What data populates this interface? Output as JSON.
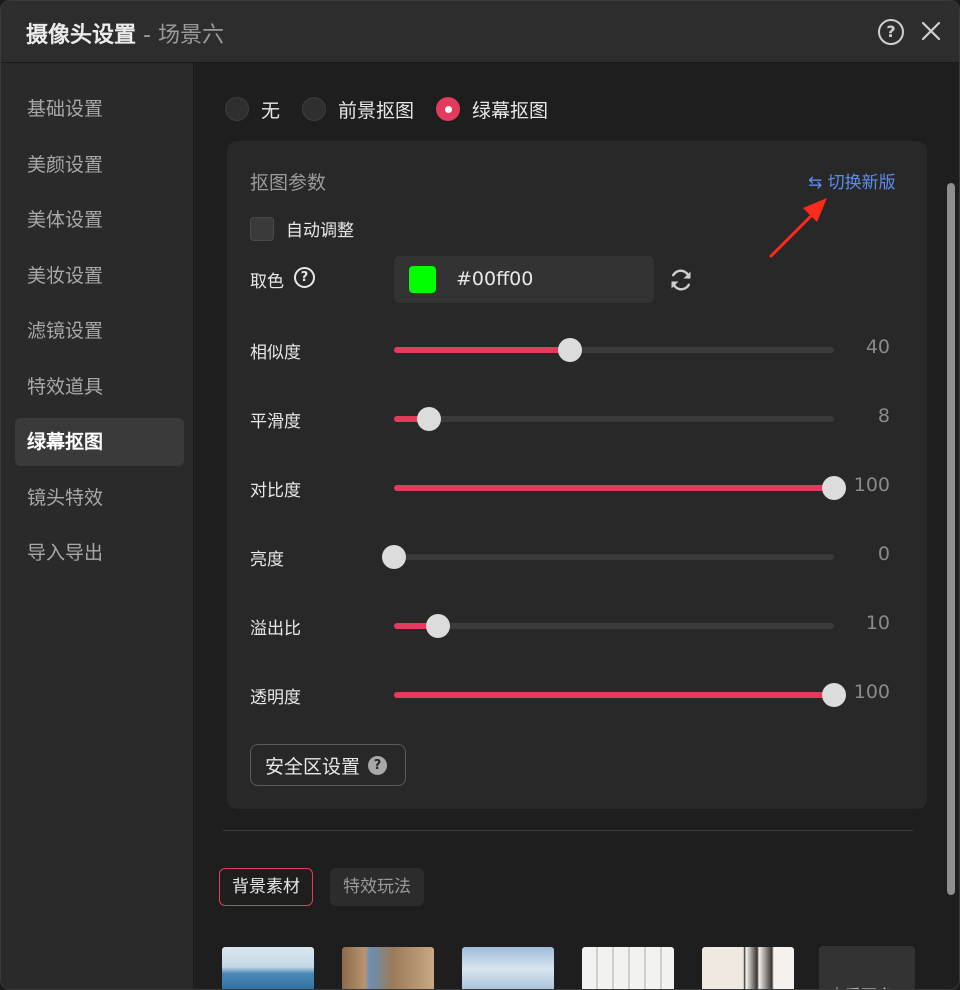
{
  "window": {
    "title_main": "摄像头设置",
    "title_sep": " - ",
    "title_sub": "场景六",
    "help_label": "?",
    "help_icon": "question-circle-icon",
    "close_icon": "close-x-icon"
  },
  "sidebar": {
    "items": [
      {
        "label": "基础设置",
        "active": false
      },
      {
        "label": "美颜设置",
        "active": false
      },
      {
        "label": "美体设置",
        "active": false
      },
      {
        "label": "美妆设置",
        "active": false
      },
      {
        "label": "滤镜设置",
        "active": false
      },
      {
        "label": "特效道具",
        "active": false
      },
      {
        "label": "绿幕抠图",
        "active": true
      },
      {
        "label": "镜头特效",
        "active": false
      },
      {
        "label": "导入导出",
        "active": false
      }
    ]
  },
  "mode": {
    "options": [
      {
        "label": "无",
        "checked": false
      },
      {
        "label": "前景抠图",
        "checked": false
      },
      {
        "label": "绿幕抠图",
        "checked": true
      }
    ]
  },
  "panel": {
    "title": "抠图参数",
    "switch_link": "⇆ 切换新版",
    "auto_adjust_label": "自动调整",
    "auto_adjust_checked": false,
    "pick_color_label": "取色",
    "pick_color_help": "?",
    "color_hex": "#00ff00",
    "refresh_icon": "refresh-icon",
    "sliders": [
      {
        "label": "相似度",
        "value": 40,
        "max": 100
      },
      {
        "label": "平滑度",
        "value": 8,
        "max": 100
      },
      {
        "label": "对比度",
        "value": 100,
        "max": 100
      },
      {
        "label": "亮度",
        "value": 0,
        "max": 100
      },
      {
        "label": "溢出比",
        "value": 10,
        "max": 100
      },
      {
        "label": "透明度",
        "value": 100,
        "max": 100
      }
    ],
    "safe_zone_button": "安全区设置",
    "safe_zone_help": "?"
  },
  "tabs": {
    "background": "背景素材",
    "effects": "特效玩法"
  },
  "thumbnails": {
    "more_label": "查看更多"
  },
  "colors": {
    "accent": "#e43a5b",
    "link": "#5b8cf0",
    "picked": "#00ff00",
    "annotation_arrow": "#ff2a1a"
  }
}
